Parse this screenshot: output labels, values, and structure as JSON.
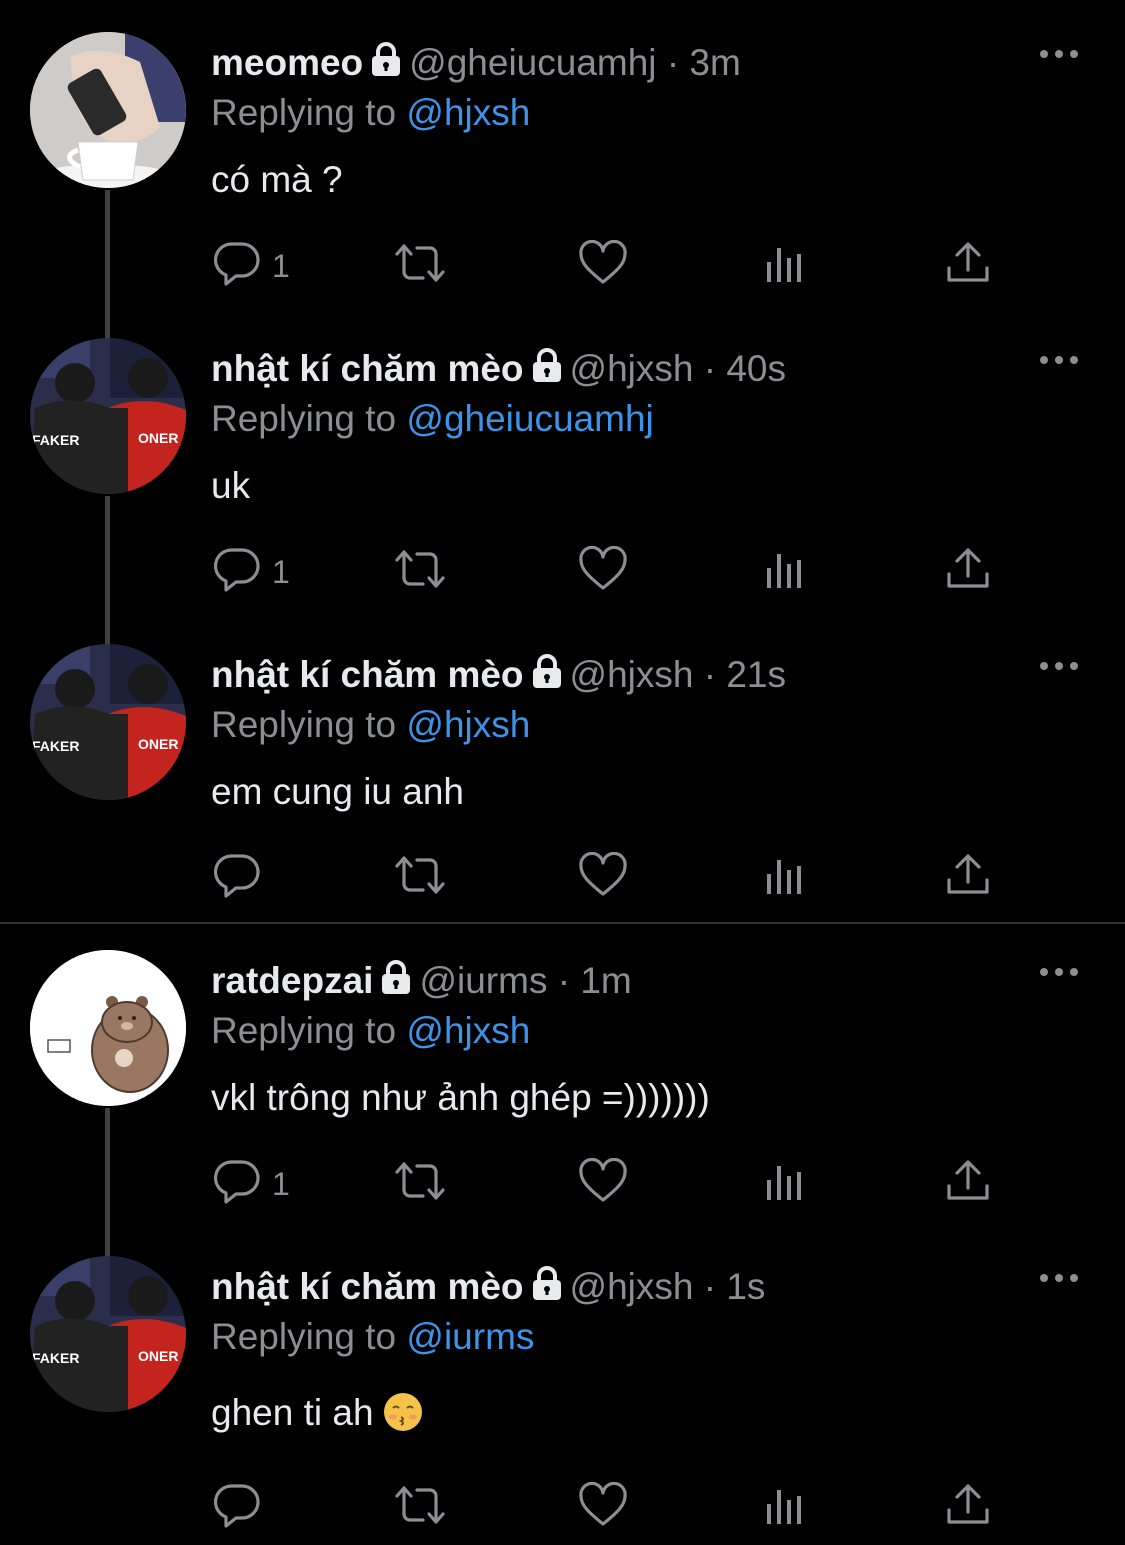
{
  "tweets": [
    {
      "name": "meomeo",
      "handle": "@gheiucuamhj",
      "dot": "·",
      "time": "3m",
      "reply_prefix": "Replying to",
      "reply_to": "@hjxsh",
      "text": "có mà ?",
      "reply_count": "1",
      "avatar": "coffee-hand-avatar"
    },
    {
      "name": "nhật kí chăm mèo",
      "handle": "@hjxsh",
      "dot": "·",
      "time": "40s",
      "reply_prefix": "Replying to",
      "reply_to": "@gheiucuamhj",
      "text": "uk",
      "reply_count": "1",
      "avatar": "faker-oner-avatar",
      "avatar_labels": [
        "FAKER",
        "ONER"
      ]
    },
    {
      "name": "nhật kí chăm mèo",
      "handle": "@hjxsh",
      "dot": "·",
      "time": "21s",
      "reply_prefix": "Replying to",
      "reply_to": "@hjxsh",
      "text": "em cung iu anh",
      "reply_count": "",
      "avatar": "faker-oner-avatar",
      "avatar_labels": [
        "FAKER",
        "ONER"
      ]
    },
    {
      "name": "ratdepzai",
      "handle": "@iurms",
      "dot": "·",
      "time": "1m",
      "reply_prefix": "Replying to",
      "reply_to": "@hjxsh",
      "text": "vkl trông như ảnh ghép =)))))))",
      "reply_count": "1",
      "avatar": "bear-avatar"
    },
    {
      "name": "nhật kí chăm mèo",
      "handle": "@hjxsh",
      "dot": "·",
      "time": "1s",
      "reply_prefix": "Replying to",
      "reply_to": "@iurms",
      "text": "ghen ti ah",
      "emoji": "kissing-face-emoji",
      "reply_count": "",
      "avatar": "faker-oner-avatar",
      "avatar_labels": [
        "FAKER",
        "ONER"
      ]
    }
  ],
  "icons": {
    "reply": "comment-icon",
    "retweet": "retweet-icon",
    "like": "heart-icon",
    "views": "analytics-icon",
    "share": "share-icon",
    "more": "more-options-icon",
    "protected": "lock-icon"
  },
  "colors": {
    "background": "#000000",
    "text": "#e7e9ea",
    "secondary": "#8b8f94",
    "mention": "#3d93e8",
    "thread_line": "#3e4144"
  }
}
